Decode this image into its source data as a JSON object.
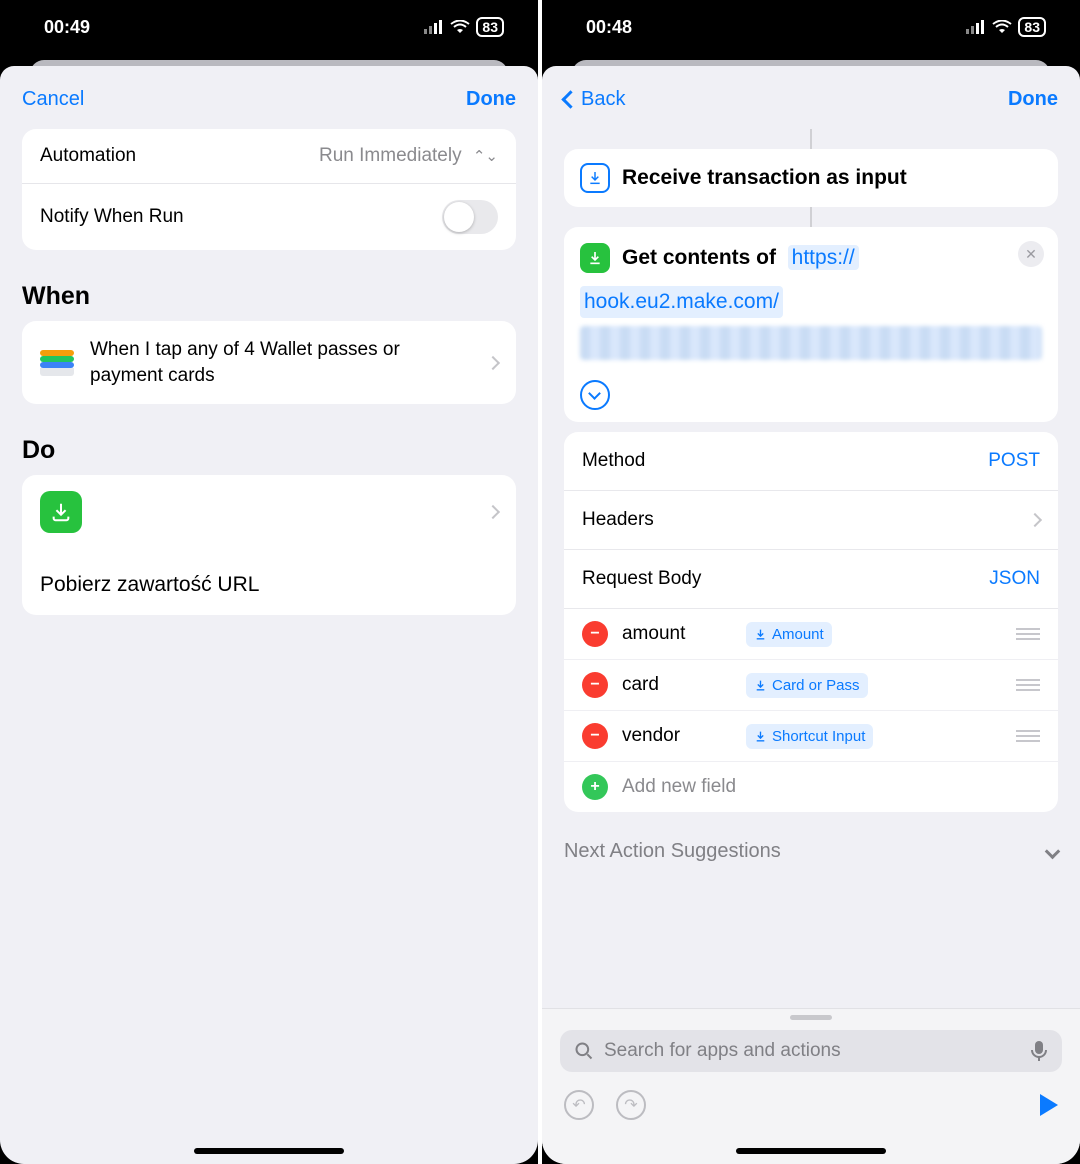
{
  "left": {
    "status_time": "00:49",
    "battery": "83",
    "nav": {
      "cancel": "Cancel",
      "done": "Done"
    },
    "settings": {
      "automation_label": "Automation",
      "automation_value": "Run Immediately",
      "notify_label": "Notify When Run"
    },
    "when_title": "When",
    "do_title": "Do",
    "trigger_text": "When I tap any of 4 Wallet passes or payment cards",
    "action_title": "Pobierz zawartość URL"
  },
  "right": {
    "status_time": "00:48",
    "battery": "83",
    "nav": {
      "back": "Back",
      "done": "Done"
    },
    "step_input": "Receive transaction as input",
    "get_contents_prefix": "Get contents of",
    "url_line1": "https://",
    "url_line2": "hook.eu2.make.com/",
    "method_label": "Method",
    "method_value": "POST",
    "headers_label": "Headers",
    "body_label": "Request Body",
    "body_value": "JSON",
    "fields": [
      {
        "key": "amount",
        "token": "Amount"
      },
      {
        "key": "card",
        "token": "Card or Pass"
      },
      {
        "key": "vendor",
        "token": "Shortcut Input"
      }
    ],
    "add_field": "Add new field",
    "next_suggestions": "Next Action Suggestions",
    "search_placeholder": "Search for apps and actions"
  }
}
